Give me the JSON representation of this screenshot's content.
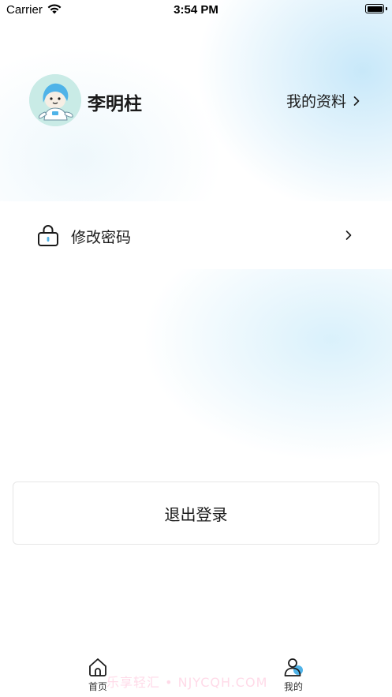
{
  "status_bar": {
    "carrier": "Carrier",
    "time": "3:54 PM",
    "wifi_icon": "wifi-icon",
    "battery_icon": "battery-icon"
  },
  "profile": {
    "avatar_icon": "seal-mascot-avatar",
    "name": "李明柱",
    "link_label": "我的资料",
    "link_icon": "chevron-right-icon"
  },
  "menu": {
    "items": [
      {
        "icon": "lock-icon",
        "label": "修改密码",
        "chevron": "chevron-right-icon"
      }
    ]
  },
  "logout": {
    "label": "退出登录"
  },
  "tab_bar": {
    "tabs": [
      {
        "label": "首页",
        "icon": "home-icon",
        "active": false
      },
      {
        "label": "我的",
        "icon": "user-icon",
        "active": true
      }
    ]
  },
  "watermark": "乐享轻汇 • NJYCQH.COM",
  "colors": {
    "accent": "#4fb3e8",
    "avatar_bg": "#c9ebe6",
    "text": "#1a1a1a",
    "border": "#e6e6e6"
  }
}
